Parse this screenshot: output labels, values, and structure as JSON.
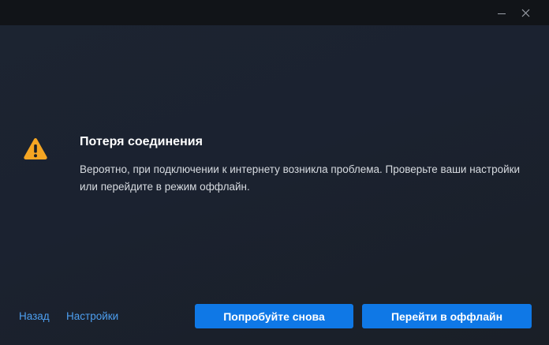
{
  "window": {
    "minimize_icon": "minimize-icon",
    "close_icon": "close-icon",
    "close_glyph": "✕"
  },
  "dialog": {
    "icon": "warning-icon",
    "icon_color": "#f5a623",
    "title": "Потеря соединения",
    "message": "Вероятно, при подключении к интернету возникла проблема. Проверьте ваши настройки или перейдите в режим оффлайн."
  },
  "footer": {
    "back_label": "Назад",
    "settings_label": "Настройки",
    "retry_label": "Попробуйте снова",
    "offline_label": "Перейти в оффлайн"
  },
  "colors": {
    "accent": "#0f78e6",
    "link": "#4d9ff0",
    "background": "#1c2431"
  }
}
